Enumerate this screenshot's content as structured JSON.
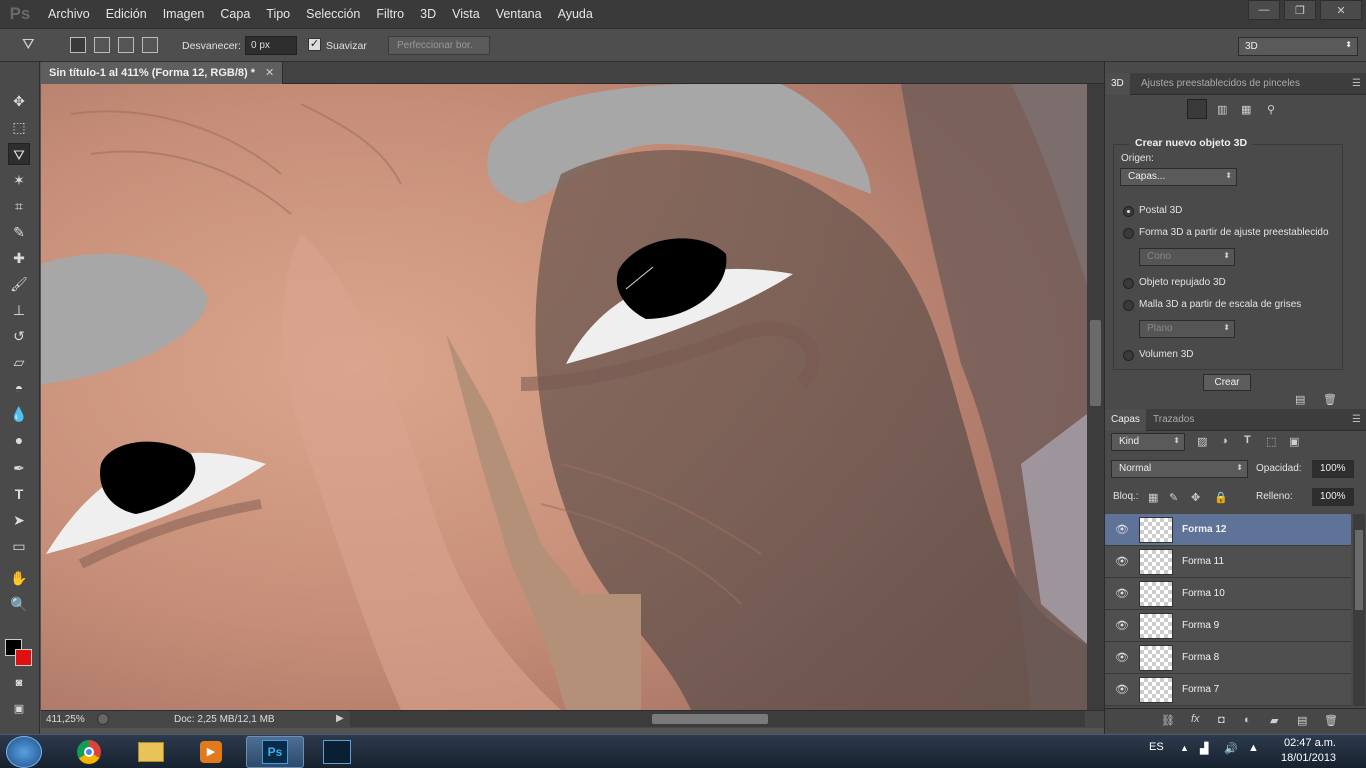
{
  "app": {
    "logo": "Ps"
  },
  "menu": [
    "Archivo",
    "Edición",
    "Imagen",
    "Capa",
    "Tipo",
    "Selección",
    "Filtro",
    "3D",
    "Vista",
    "Ventana",
    "Ayuda"
  ],
  "window_controls": {
    "minimize": "—",
    "restore": "❐",
    "close": "✕"
  },
  "options": {
    "feather_label": "Desvanecer:",
    "feather_value": "0 px",
    "antialias_label": "Suavizar",
    "refine_edge_label": "Perfeccionar bor.",
    "workspace": "3D"
  },
  "document": {
    "tab_title": "Sin título-1 al 411% (Forma 12, RGB/8) *",
    "zoom": "411,25%",
    "doc_info": "Doc: 2,25 MB/12,1 MB"
  },
  "panel3d": {
    "tabs": [
      "3D",
      "Ajustes preestablecidos de pinceles"
    ],
    "group_title": "Crear nuevo objeto 3D",
    "origin_label": "Origen:",
    "origin_value": "Capas...",
    "options": [
      "Postal 3D",
      "Forma 3D a partir de ajuste preestablecido",
      "Objeto repujado 3D",
      "Malla 3D a partir de escala de grises",
      "Volumen 3D"
    ],
    "preset_value": "Cono",
    "grayscale_value": "Plano",
    "create_button": "Crear"
  },
  "layers_panel": {
    "tabs": [
      "Capas",
      "Trazados"
    ],
    "filter_kind": "Kind",
    "blend_mode": "Normal",
    "opacity_label": "Opacidad:",
    "opacity_value": "100%",
    "lock_label": "Bloq.:",
    "fill_label": "Relleno:",
    "fill_value": "100%",
    "layers": [
      "Forma 12",
      "Forma 11",
      "Forma 10",
      "Forma 9",
      "Forma 8",
      "Forma 7"
    ],
    "selected_layer": "Forma 12"
  },
  "taskbar": {
    "language": "ES",
    "time": "02:47 a.m.",
    "date": "18/01/2013"
  },
  "colors": {
    "foreground": "#000000",
    "background": "#e01010",
    "selected_layer": "#5f7399"
  }
}
